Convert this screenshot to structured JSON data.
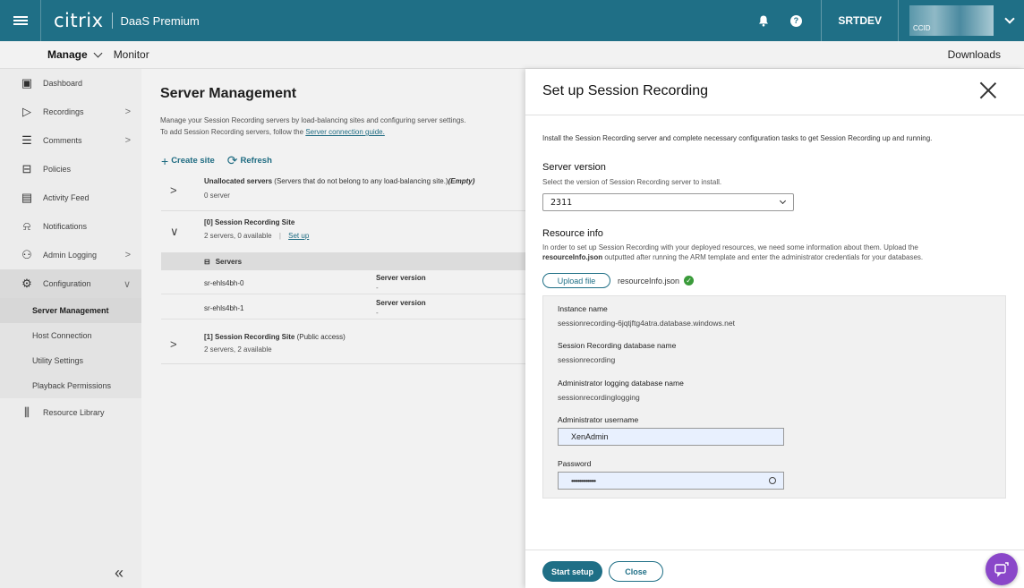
{
  "topbar": {
    "logo": "citrix",
    "product": "DaaS Premium",
    "help_glyph": "?",
    "customer": "SRTDEV",
    "ccid_label": "CCID"
  },
  "subnav": {
    "manage": "Manage",
    "monitor": "Monitor",
    "downloads": "Downloads"
  },
  "sidebar": {
    "items": [
      {
        "label": "Dashboard",
        "icon": "dashboard-icon",
        "glyph": "▣"
      },
      {
        "label": "Recordings",
        "icon": "play-circle-icon",
        "glyph": "▷",
        "arrow": ">"
      },
      {
        "label": "Comments",
        "icon": "comment-icon",
        "glyph": "☰",
        "arrow": ">"
      },
      {
        "label": "Policies",
        "icon": "policy-icon",
        "glyph": "⊟"
      },
      {
        "label": "Activity Feed",
        "icon": "activity-feed-icon",
        "glyph": "▤"
      },
      {
        "label": "Notifications",
        "icon": "bell-icon",
        "glyph": "⍾"
      },
      {
        "label": "Admin Logging",
        "icon": "admin-logging-icon",
        "glyph": "⚇",
        "arrow": ">"
      },
      {
        "label": "Configuration",
        "icon": "gear-icon",
        "glyph": "⚙",
        "arrow": "∨"
      }
    ],
    "sub_items": [
      "Server Management",
      "Host Connection",
      "Utility Settings",
      "Playback Permissions"
    ],
    "resource_library": {
      "label": "Resource Library",
      "glyph": "⫼"
    },
    "collapse": "«"
  },
  "main": {
    "title": "Server Management",
    "desc_line1": "Manage your Session Recording servers by load-balancing sites and configuring server settings.",
    "desc_line2": "To add Session Recording servers, follow the",
    "desc_link": "Server connection guide.",
    "create_site": "Create site",
    "refresh": "Refresh",
    "unallocated_title": "Unallocated servers",
    "unallocated_note": "(Servers that do not belong to any load-balancing site.)",
    "unallocated_empty": "(Empty)",
    "unallocated_count": "0 server",
    "site0_title": "[0] Session Recording Site",
    "site0_sub": "2 servers, 0 available",
    "site0_sep": "|",
    "site0_link": "Set up",
    "servers_header": "Servers",
    "servers": [
      {
        "name": "sr-ehls4bh-0",
        "ver_label": "Server version",
        "ver": "-"
      },
      {
        "name": "sr-ehls4bh-1",
        "ver_label": "Server version",
        "ver": "-"
      }
    ],
    "site1_title": "[1] Session Recording Site",
    "site1_note": "(Public access)",
    "site1_sub": "2 servers, 2 available"
  },
  "panel": {
    "title": "Set up Session Recording",
    "intro": "Install the Session Recording server and complete necessary configuration tasks to get Session Recording up and running.",
    "server_version_label": "Server version",
    "server_version_help": "Select the version of Session Recording server to install.",
    "server_version_value": "2311",
    "resource_info_label": "Resource info",
    "resource_info_help1": "In order to set up Session Recording with your deployed resources, we need some information about them. Upload the",
    "resource_info_help2_bold": "resourceInfo.json",
    "resource_info_help2": "outputted after running the ARM template and enter the administrator credentials for your databases.",
    "upload_label": "Upload file",
    "file_name": "resourceInfo.json",
    "instance_name_label": "Instance name",
    "instance_name": "sessionrecording-6jqtjftg4atra.database.windows.net",
    "sr_db_label": "Session Recording database name",
    "sr_db": "sessionrecording",
    "al_db_label": "Administrator logging database name",
    "al_db": "sessionrecordinglogging",
    "admin_user_label": "Administrator username",
    "admin_user": "XenAdmin",
    "password_label": "Password",
    "password_mask": "•••••••••••••••",
    "start_setup": "Start setup",
    "close": "Close"
  },
  "colors": {
    "brand": "#1f6f86",
    "fab": "#8a47c9",
    "success": "#3a9b3a"
  }
}
